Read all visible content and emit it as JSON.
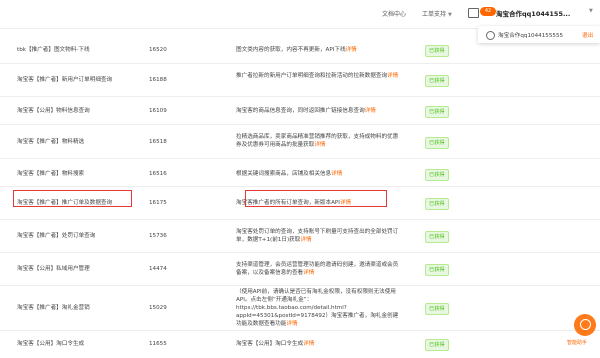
{
  "header": {
    "doc_center": "文档中心",
    "support": "工单支持",
    "badge_count": "42",
    "username": "淘宝合作qq1044155..."
  },
  "account_popover": {
    "account": "淘宝合作qq1044155555",
    "logout": "退出"
  },
  "rows": [
    {
      "name": "tbk【推广者】图文物料-下线",
      "id": "16520",
      "desc": "图文类内容的获取，内容不再更新，API下线",
      "desc_link": "详情",
      "status": "已获得"
    },
    {
      "name": "淘宝客【推广者】新用户订单明细查询",
      "id": "16188",
      "desc": "推广者拉新的新用户订单明细查询和拉新活动的拉新数据查询",
      "desc_link": "详情",
      "status": "已获得"
    },
    {
      "name": "淘宝客【公用】物料信息查询",
      "id": "16109",
      "desc": "淘宝客的商品信息查询，同时返回推广链接信息查询",
      "desc_link": "详情",
      "status": "已获得"
    },
    {
      "name": "淘宝客【推广者】物料精选",
      "id": "16518",
      "desc": "拉精选商品库，卖家商品精准营销推荐的获取，支持成物料的优惠券及优惠券可用商品的批量获取",
      "desc_link": "详情",
      "status": "已获得"
    },
    {
      "name": "淘宝客【推广者】物料搜索",
      "id": "16516",
      "desc": "根据关键词搜索商品，店铺及相关信息",
      "desc_link": "详情",
      "status": "已获得"
    },
    {
      "name": "淘宝客【推广者】推广订单及数据查询",
      "id": "16175",
      "desc": "淘宝客推广者的所有订单查询，新版本API",
      "desc_link": "详情",
      "status": "已获得"
    },
    {
      "name": "淘宝客【推广者】处罚订单查询",
      "id": "15736",
      "desc": "淘宝客处罚订单的查询，支持账号下刷量可支持查出的全部处罚订单，数据T+1(前1日)获取",
      "desc_link": "详情",
      "status": "已获得"
    },
    {
      "name": "淘宝客【公用】私域用户管理",
      "id": "14474",
      "desc": "支持渠道管理，会员运营管理功能的邀请码创建，邀请渠道或会员备案，以及备案信息的查看",
      "desc_link": "详情",
      "status": "已获得"
    },
    {
      "name": "淘宝客【推广者】淘礼金营销",
      "id": "15029",
      "desc": "（使用API前，请确认是否已有淘礼金权限，没有权限则无法使用API。点击左侧“开通淘礼金”：https://tbk.bbs.taobao.com/detail.html?appId=45301&postId=9178492）淘宝客推广者，淘礼金创建功能及数据查看功能",
      "desc_link": "详情",
      "status": "已获得"
    },
    {
      "name": "淘宝客【公用】淘口令生成",
      "id": "11655",
      "desc": "淘宝客【公用】淘口令生成",
      "desc_link": "详情",
      "status": "已获得"
    }
  ],
  "help_label": "智能助手"
}
